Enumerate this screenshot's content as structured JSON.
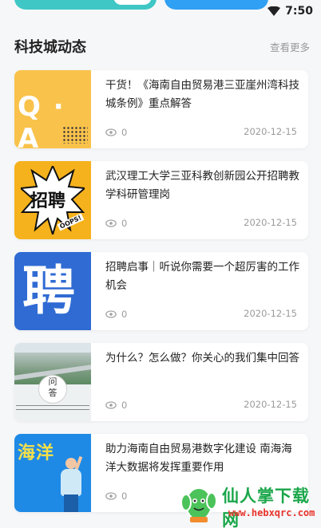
{
  "status_bar": {
    "time": "7:50"
  },
  "section": {
    "title": "科技城动态",
    "more_label": "查看更多"
  },
  "news": [
    {
      "title": "干货！《海南自由贸易港三亚崖州湾科技城条例》重点解答",
      "views": "0",
      "date": "2020-12-15",
      "thumb_icon": "qa-icon",
      "thumb_text": "Q · A"
    },
    {
      "title": "武汉理工大学三亚科教创新园公开招聘教学科研管理岗",
      "views": "0",
      "date": "2020-12-15",
      "thumb_icon": "recruit-burst-icon",
      "thumb_text": "招聘",
      "thumb_sticker": "OOPS!"
    },
    {
      "title": "招聘启事｜听说你需要一个超厉害的工作机会",
      "views": "0",
      "date": "2020-12-15",
      "thumb_icon": "hire-character-icon",
      "thumb_text": "聘"
    },
    {
      "title": "为什么？怎么做？你关心的我们集中回答",
      "views": "0",
      "date": "2020-12-15",
      "thumb_icon": "city-photo",
      "thumb_text": "问答"
    },
    {
      "title": "助力海南自由贸易港数字化建设 南海海洋大数据将发挥重要作用",
      "views": "0",
      "date": "",
      "thumb_icon": "ocean-figure-icon",
      "thumb_text": "海洋"
    }
  ],
  "watermark": {
    "name": "仙人掌下载网",
    "url": "www.hebxqrc.com"
  },
  "colors": {
    "qa": "#f9c24b",
    "recruit": "#f6b21c",
    "hire": "#2f6bd3",
    "ocean": "#1f8ae6",
    "watermark_green": "#1aa64a",
    "watermark_red": "#e8332a"
  }
}
